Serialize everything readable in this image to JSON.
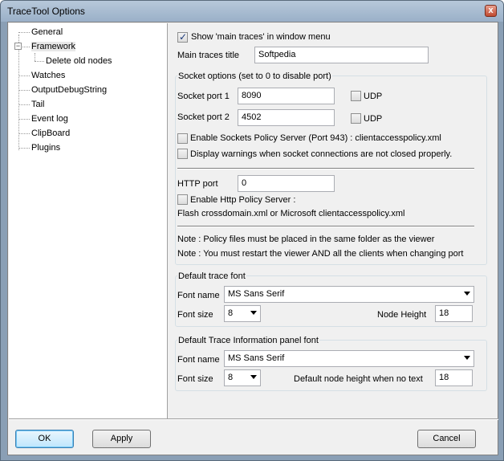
{
  "window": {
    "title": "TraceTool Options",
    "close_label": "x"
  },
  "tree": {
    "items": [
      {
        "label": "General"
      },
      {
        "label": "Framework"
      },
      {
        "label": "Delete old nodes"
      },
      {
        "label": "Watches"
      },
      {
        "label": "OutputDebugString"
      },
      {
        "label": "Tail"
      },
      {
        "label": "Event log"
      },
      {
        "label": "ClipBoard"
      },
      {
        "label": "Plugins"
      }
    ],
    "expander": "−"
  },
  "framework": {
    "show_main_traces_label": "Show 'main traces' in window menu",
    "main_traces_title_label": "Main traces title",
    "main_traces_title_value": "Softpedia",
    "socket_options_label": "Socket options (set to 0 to disable port)",
    "socket_port1_label": "Socket port 1",
    "socket_port1_value": "8090",
    "socket_port2_label": "Socket port 2",
    "socket_port2_value": "4502",
    "udp_label": "UDP",
    "enable_sockets_policy_label": "Enable Sockets Policy Server (Port 943) : clientaccesspolicy.xml",
    "display_warnings_label": "Display warnings when socket connections are not closed properly.",
    "http_port_label": "HTTP port",
    "http_port_value": "0",
    "enable_http_policy_label": "Enable Http Policy Server :",
    "http_policy_desc": "Flash crossdomain.xml or Microsoft clientaccesspolicy.xml",
    "note1": "Note : Policy files must be placed in the same folder as the viewer",
    "note2": "Note : You must restart the viewer AND all the clients when changing port",
    "default_trace_font_label": "Default trace font",
    "font_name_label": "Font name",
    "font_name_value": "MS Sans Serif",
    "font_size_label": "Font size",
    "font_size_value": "8",
    "node_height_label": "Node Height",
    "node_height_value": "18",
    "info_panel_font_label": "Default Trace Information panel font",
    "info_font_name_value": "MS Sans Serif",
    "info_font_size_value": "8",
    "default_node_height_label": "Default node height when no text",
    "default_node_height_value": "18"
  },
  "buttons": {
    "ok": "OK",
    "apply": "Apply",
    "cancel": "Cancel"
  }
}
